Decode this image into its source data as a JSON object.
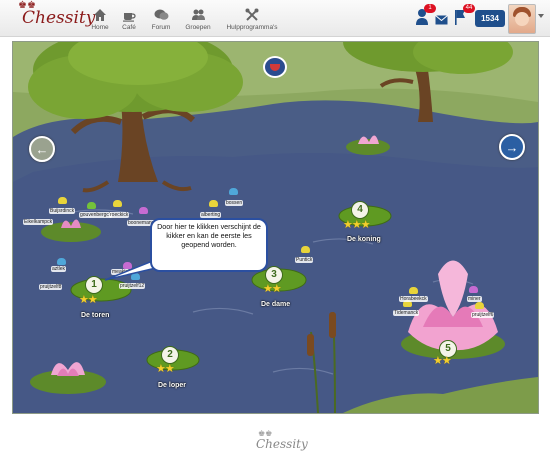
{
  "header": {
    "logo": "Chessity",
    "nav": [
      {
        "label": "Home",
        "icon": "home-icon"
      },
      {
        "label": "Café",
        "icon": "coffee-cup-icon"
      },
      {
        "label": "Forum",
        "icon": "speech-bubbles-icon"
      },
      {
        "label": "Groepen",
        "icon": "group-icon"
      },
      {
        "label": "Hulpprogramma's",
        "icon": "tools-icon"
      }
    ],
    "notifications": [
      {
        "icon": "user-alert-icon",
        "count": "1"
      },
      {
        "icon": "mail-icon",
        "count": ""
      },
      {
        "icon": "flag-icon",
        "count": "44"
      }
    ],
    "rating": "1534"
  },
  "scene": {
    "lessons": [
      {
        "number": "1",
        "label": "De toren",
        "stars": "★★"
      },
      {
        "number": "2",
        "label": "De loper",
        "stars": "★★"
      },
      {
        "number": "3",
        "label": "De dame",
        "stars": "★★"
      },
      {
        "number": "4",
        "label": "De koning",
        "stars": "★★★"
      },
      {
        "number": "5",
        "label": "",
        "stars": "★★"
      }
    ],
    "tooltip": "Door hier te klikken verschijnt de kikker en kan de eerste les geopend worden.",
    "players": [
      "Eikelkampck",
      "Buijsrdinck",
      "gouvenbergck",
      "roeckick",
      "boonemans",
      "alberting",
      "bossen",
      "aztlek",
      "meakte",
      "pruijtzelf8",
      "pruijtzelf12",
      "Puntick",
      "Horabeekck",
      "Tidemanck",
      "miner",
      "pruijtzelf6"
    ]
  },
  "footer": {
    "logo": "Chessity"
  }
}
